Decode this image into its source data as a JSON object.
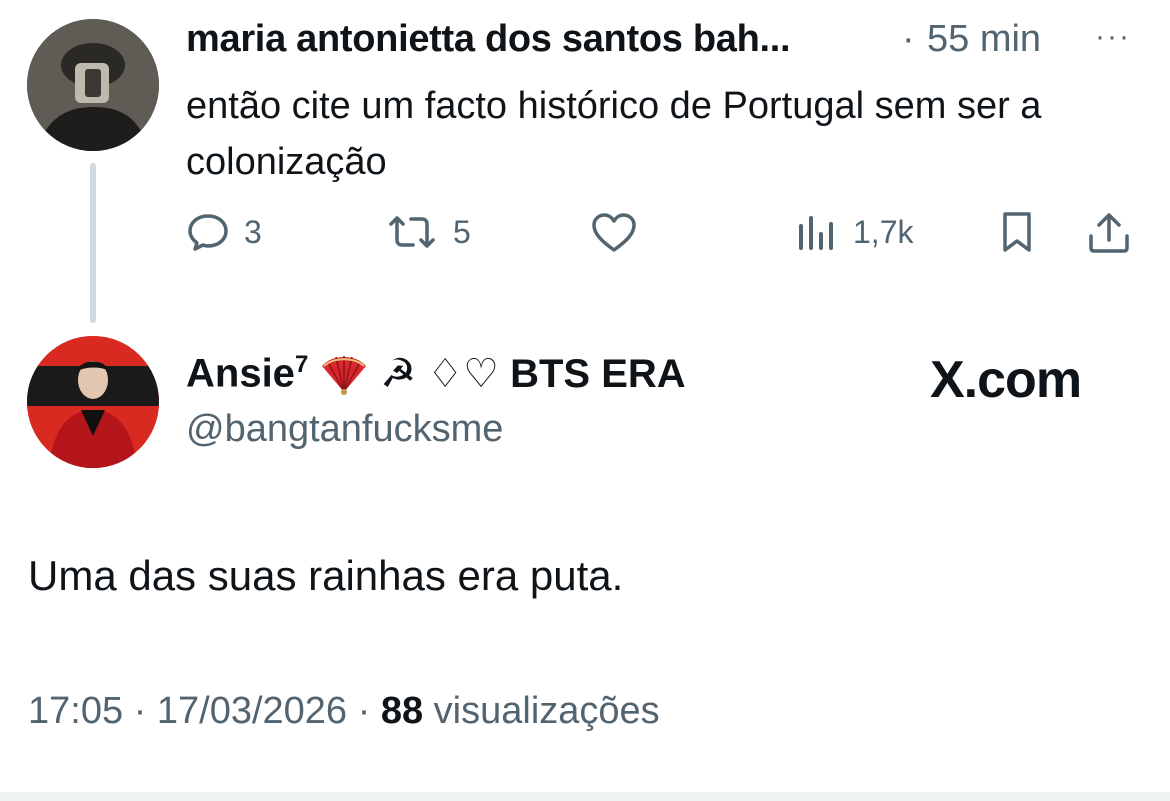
{
  "tweet1": {
    "author": "maria antonietta dos santos bah...",
    "separator": "·",
    "time": "55 min",
    "more": "···",
    "text": "então cite um facto histórico de Portugal sem ser a colonização",
    "replies": "3",
    "retweets": "5",
    "views": "1,7k"
  },
  "tweet2": {
    "author_name": "Ansie",
    "author_sup": "7",
    "author_suffix": "☭ ♢♡ BTS ERA",
    "handle": "@bangtanfucksme",
    "watermark": "X.com",
    "text": "Uma das suas rainhas era puta.",
    "time": "17:05 · 17/03/2026 ·",
    "views_count": "88",
    "views_label": "visualizações"
  }
}
